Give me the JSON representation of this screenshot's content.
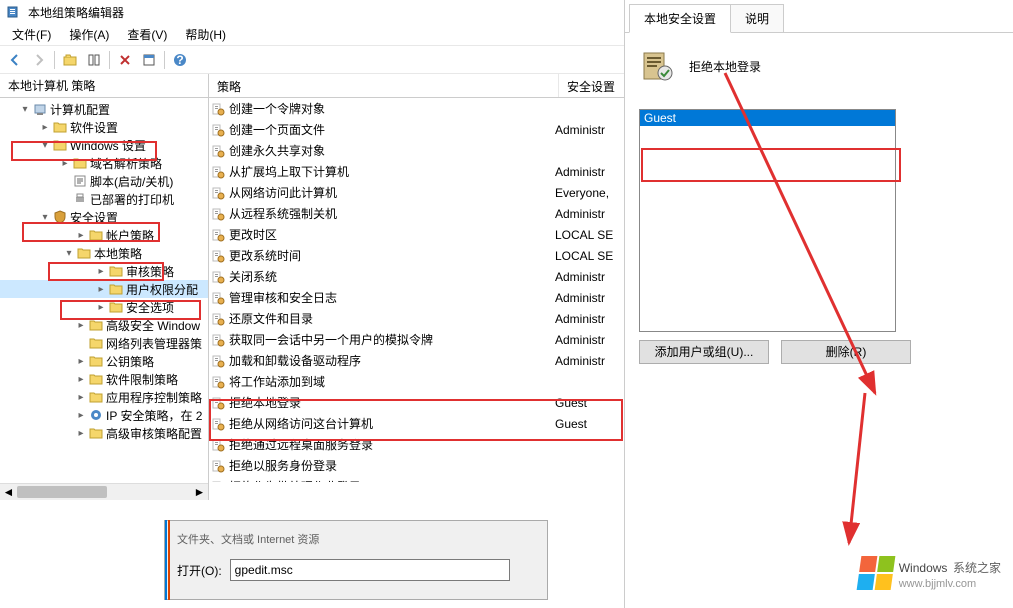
{
  "window_title": "本地组策略编辑器",
  "menubar": [
    {
      "label": "文件(F)"
    },
    {
      "label": "操作(A)"
    },
    {
      "label": "查看(V)"
    },
    {
      "label": "帮助(H)"
    }
  ],
  "tree_header": "本地计算机 策略",
  "tree": {
    "root": {
      "label": "计算机配置",
      "indent": 18
    },
    "items": [
      {
        "label": "软件设置",
        "indent": 38,
        "exp": ">"
      },
      {
        "label": "Windows 设置",
        "indent": 38,
        "exp": "v",
        "box": true
      },
      {
        "label": "域名解析策略",
        "indent": 58,
        "exp": ">"
      },
      {
        "label": "脚本(启动/关机)",
        "indent": 58,
        "exp": "",
        "icon": "script"
      },
      {
        "label": "已部署的打印机",
        "indent": 58,
        "exp": "",
        "icon": "printer"
      },
      {
        "label": "安全设置",
        "indent": 38,
        "exp": "v",
        "box": true,
        "icon": "shield"
      },
      {
        "label": "帐户策略",
        "indent": 74,
        "exp": ">"
      },
      {
        "label": "本地策略",
        "indent": 62,
        "exp": "v",
        "box": true
      },
      {
        "label": "审核策略",
        "indent": 94,
        "exp": ">"
      },
      {
        "label": "用户权限分配",
        "indent": 94,
        "exp": ">",
        "box": true,
        "sel": true
      },
      {
        "label": "安全选项",
        "indent": 94,
        "exp": ">"
      },
      {
        "label": "高级安全 Window",
        "indent": 74,
        "exp": ">"
      },
      {
        "label": "网络列表管理器策",
        "indent": 74,
        "exp": ""
      },
      {
        "label": "公钥策略",
        "indent": 74,
        "exp": ">"
      },
      {
        "label": "软件限制策略",
        "indent": 74,
        "exp": ">"
      },
      {
        "label": "应用程序控制策略",
        "indent": 74,
        "exp": ">"
      },
      {
        "label": "IP 安全策略，在 2",
        "indent": 74,
        "exp": ">",
        "icon": "ipsec"
      },
      {
        "label": "高级审核策略配置",
        "indent": 74,
        "exp": ">"
      }
    ]
  },
  "list_header": {
    "col1": "策略",
    "col2": "安全设置"
  },
  "policies": [
    {
      "name": "创建一个令牌对象",
      "setting": ""
    },
    {
      "name": "创建一个页面文件",
      "setting": "Administr"
    },
    {
      "name": "创建永久共享对象",
      "setting": ""
    },
    {
      "name": "从扩展坞上取下计算机",
      "setting": "Administr"
    },
    {
      "name": "从网络访问此计算机",
      "setting": "Everyone,"
    },
    {
      "name": "从远程系统强制关机",
      "setting": "Administr"
    },
    {
      "name": "更改时区",
      "setting": "LOCAL SE"
    },
    {
      "name": "更改系统时间",
      "setting": "LOCAL SE"
    },
    {
      "name": "关闭系统",
      "setting": "Administr"
    },
    {
      "name": "管理审核和安全日志",
      "setting": "Administr"
    },
    {
      "name": "还原文件和目录",
      "setting": "Administr"
    },
    {
      "name": "获取同一会话中另一个用户的模拟令牌",
      "setting": "Administr"
    },
    {
      "name": "加载和卸载设备驱动程序",
      "setting": "Administr"
    },
    {
      "name": "将工作站添加到域",
      "setting": ""
    },
    {
      "name": "拒绝本地登录",
      "setting": "Guest",
      "box": "top-open"
    },
    {
      "name": "拒绝从网络访问这台计算机",
      "setting": "Guest",
      "box": "bot-open"
    },
    {
      "name": "拒绝通过远程桌面服务登录",
      "setting": ""
    },
    {
      "name": "拒绝以服务身份登录",
      "setting": ""
    },
    {
      "name": "拒绝作为批处理作业登录",
      "setting": ""
    }
  ],
  "props_tabs": {
    "tab1": "本地安全设置",
    "tab2": "说明"
  },
  "props_policy_name": "拒绝本地登录",
  "props_list": [
    {
      "label": "Guest",
      "selected": true
    }
  ],
  "props_buttons": {
    "add": "添加用户或组(U)...",
    "remove": "删除(R)"
  },
  "run": {
    "label": "打开(O):",
    "value": "gpedit.msc",
    "info": "文件夹、文档或 Internet 资源"
  },
  "watermark": {
    "brand": "Windows",
    "suffix": "系统之家",
    "url": "www.bjjmlv.com"
  }
}
